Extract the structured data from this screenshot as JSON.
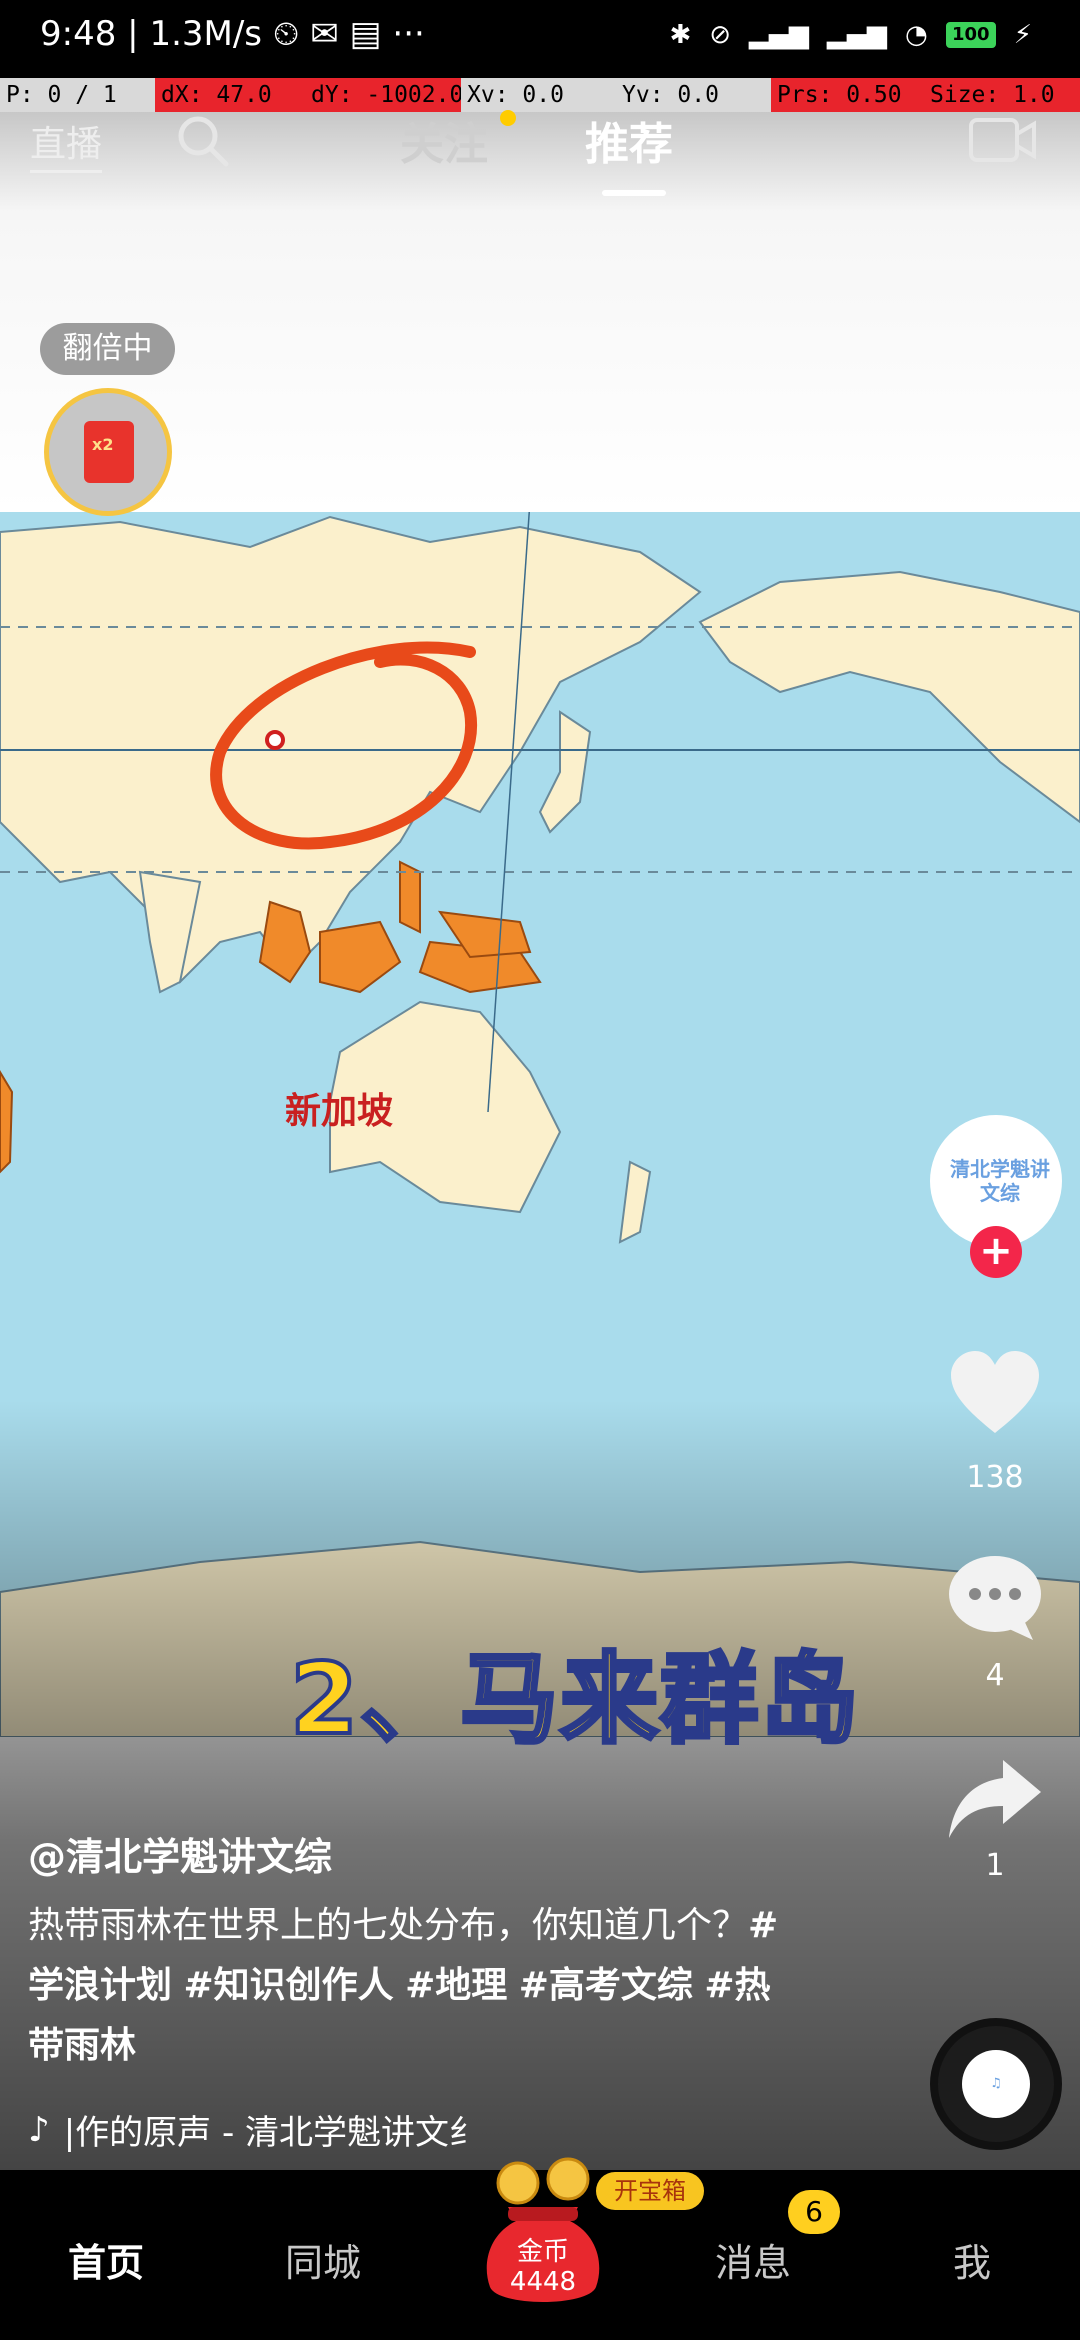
{
  "status_bar": {
    "time": "9:48",
    "speed": "1.3M/s",
    "battery": "100"
  },
  "debug_overlay": {
    "pointer": "P: 0 / 1",
    "dx": "dX: 47.0",
    "dy": "dY: -1002.0",
    "xv": "Xv: 0.0",
    "yv": "Yv: 0.0",
    "prs": "Prs: 0.50",
    "size": "Size: 1.0"
  },
  "top_nav": {
    "live": "直播",
    "follow": "关注",
    "recommend": "推荐"
  },
  "promo": {
    "badge": "翻倍中",
    "multiplier": "x2"
  },
  "video": {
    "map_label": "新加坡",
    "caption": "2、马来群岛"
  },
  "creator": {
    "avatar_text": "清北学魁讲文综"
  },
  "actions": {
    "likes": "138",
    "comments": "4",
    "shares": "1"
  },
  "post": {
    "author": "@清北学魁讲文综",
    "description_text": "热带雨林在世界上的七处分布，你知道几个？",
    "hashtags": [
      "#学浪计划",
      "#知识创作人",
      "#地理",
      "#高考文综",
      "#热带雨林"
    ],
    "music": "|作的原声 - 清北学魁讲文纟"
  },
  "tab_bar": {
    "home": "首页",
    "city": "同城",
    "treasure_label": "开宝箱",
    "coins_label": "金币",
    "coins_value": "4448",
    "messages": "消息",
    "messages_badge": "6",
    "me": "我"
  }
}
